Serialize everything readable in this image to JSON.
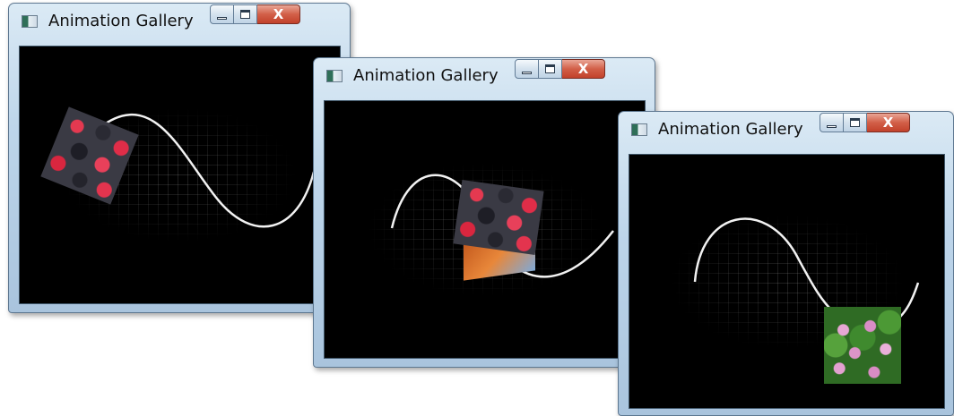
{
  "windows": [
    {
      "title": "Animation Gallery",
      "close_glyph": "X"
    },
    {
      "title": "Animation Gallery",
      "close_glyph": "X"
    },
    {
      "title": "Animation Gallery",
      "close_glyph": "X"
    }
  ],
  "icons": {
    "app": "app-window-icon",
    "minimize": "minimize-icon",
    "maximize": "maximize-icon",
    "close": "close-icon"
  },
  "colors": {
    "client_background": "#000000",
    "curve": "#f2f2f2",
    "close_button": "#c94a33"
  }
}
